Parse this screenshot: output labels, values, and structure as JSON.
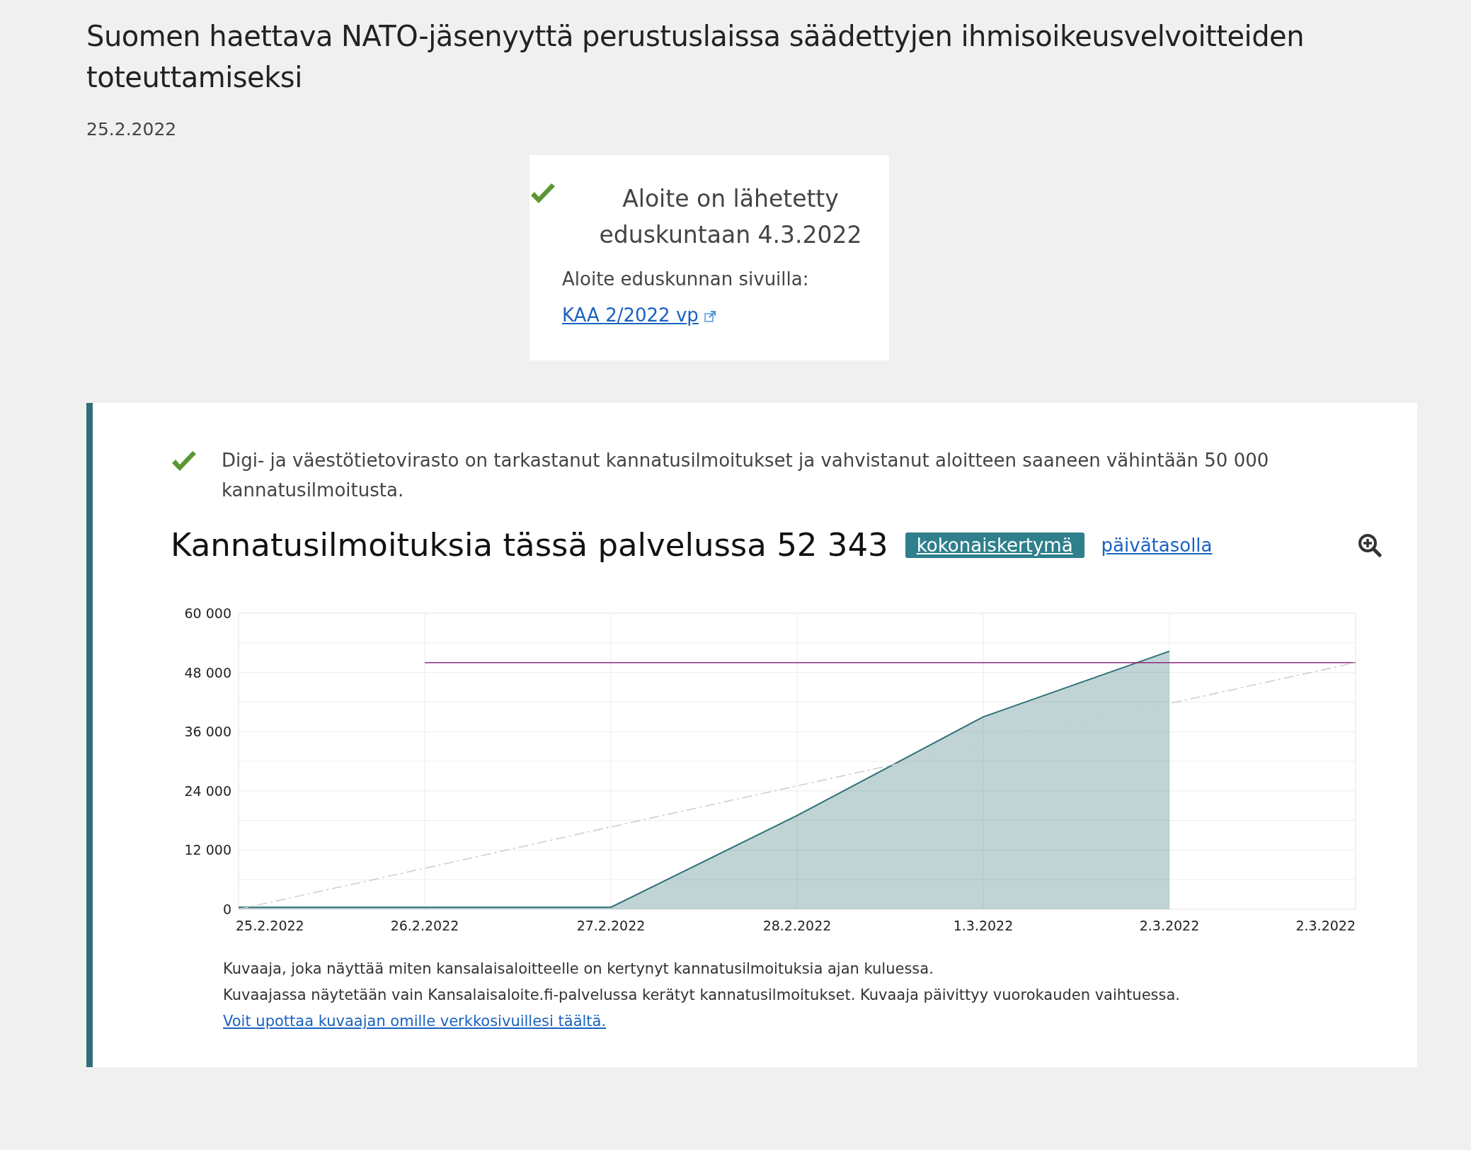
{
  "title": "Suomen haettava NATO-jäsenyyttä perustuslaissa säädettyjen ihmisoikeusvelvoitteiden toteuttamiseksi",
  "date": "25.2.2022",
  "status_box": {
    "heading": "Aloite on lähetetty eduskuntaan 4.3.2022",
    "label": "Aloite eduskunnan sivuilla:",
    "link": "KAA 2/2022 vp"
  },
  "verification": "Digi- ja väestötietovirasto on tarkastanut kannatusilmoitukset ja vahvistanut aloitteen saaneen vähintään 50 000 kannatusilmoitusta.",
  "stats": {
    "heading": "Kannatusilmoituksia tässä palvelussa 52 343",
    "views": [
      {
        "label": "kokonaiskertymä",
        "selected": true
      },
      {
        "label": "päivätasolla",
        "selected": false
      }
    ],
    "chart_data": {
      "type": "area",
      "categories": [
        "25.2.2022",
        "26.2.2022",
        "27.2.2022",
        "28.2.2022",
        "1.3.2022",
        "2.3.2022",
        "2.3.2022"
      ],
      "grid": true,
      "ylim": [
        0,
        60000
      ],
      "yticks": [
        {
          "value": 0,
          "label": "0"
        },
        {
          "value": 12000,
          "label": "12 000"
        },
        {
          "value": 24000,
          "label": "24 000"
        },
        {
          "value": 36000,
          "label": "36 000"
        },
        {
          "value": 48000,
          "label": "48 000"
        },
        {
          "value": 60000,
          "label": "60 000"
        }
      ],
      "series": [
        {
          "color": "#2f6f78",
          "values": [
            400,
            400,
            400,
            19000,
            39000,
            52300,
            null
          ]
        },
        {
          "type": "line",
          "color": "#8e2a78",
          "values": [
            null,
            50000,
            50000,
            50000,
            50000,
            50000,
            50000
          ]
        },
        {
          "type": "line",
          "line_style": "dashdot",
          "color": "#cccccc",
          "values": [
            0,
            8300,
            16700,
            25000,
            33300,
            41700,
            50000
          ]
        }
      ]
    },
    "notes": [
      "Kuvaaja, joka näyttää miten kansalaisaloitteelle on kertynyt kannatusilmoituksia ajan kuluessa.",
      "Kuvaajassa näytetään vain Kansalaisaloite.fi-palvelussa kerätyt kannatusilmoitukset. Kuvaaja päivittyy vuorokauden vaihtuessa."
    ],
    "embed_link": "Voit upottaa kuvaajan omille verkkosivuillesi täältä."
  }
}
